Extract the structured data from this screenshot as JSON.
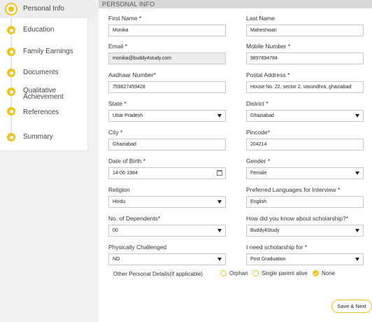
{
  "sidebar": {
    "items": [
      {
        "label": "Personal Info"
      },
      {
        "label": "Education"
      },
      {
        "label": "Family Earnings"
      },
      {
        "label": "Documents"
      },
      {
        "label": "Qualitative\nAchievement"
      },
      {
        "label": "References"
      },
      {
        "label": "Summary"
      }
    ]
  },
  "section": {
    "title": "PERSONAL INFO"
  },
  "fields": {
    "first_name": {
      "label": "First Name *",
      "value": "Monika"
    },
    "last_name": {
      "label": "Last Name",
      "value": "Maheshwari"
    },
    "email": {
      "label": "Email *",
      "value": "monika@buddy4study.com"
    },
    "mobile": {
      "label": "Mobile Number *",
      "value": "9897894784"
    },
    "aadhaar": {
      "label": "Aadhaar Number*",
      "value": "759827459428"
    },
    "postal": {
      "label": "Postal Address *",
      "value": "House No. 22, sector 2, vasundhra, ghaziabad"
    },
    "state": {
      "label": "State *",
      "value": "Uttar Pradesh"
    },
    "district": {
      "label": "District *",
      "value": "Ghaziabad"
    },
    "city": {
      "label": "City *",
      "value": "Ghaziabad"
    },
    "pincode": {
      "label": "Pincode*",
      "value": "204214"
    },
    "dob": {
      "label": "Date of Birth *",
      "value": "14-06-1984"
    },
    "gender": {
      "label": "Gender *",
      "value": "Female"
    },
    "religion": {
      "label": "Religion",
      "value": "Hindu"
    },
    "language": {
      "label": "Preferred Languages for Interview *",
      "value": "English"
    },
    "dependents": {
      "label": "No. of Dependents*",
      "value": "00"
    },
    "source": {
      "label": "How did you know about scholarship?*",
      "value": "Buddy4Study"
    },
    "challenged": {
      "label": "Physically Challenged",
      "value": "NO"
    },
    "need_for": {
      "label": "I need scholarship for *",
      "value": "Post Graduation"
    }
  },
  "other_details": {
    "label": "Other Personal Details(if applicable)",
    "options": [
      "Orphan",
      "Single parent alive",
      "None"
    ],
    "selected": "None"
  },
  "save_button": "Save & Next",
  "colors": {
    "accent": "#f2c21b",
    "header": "#d7d7d7",
    "page_bg": "#f1f1f1"
  }
}
